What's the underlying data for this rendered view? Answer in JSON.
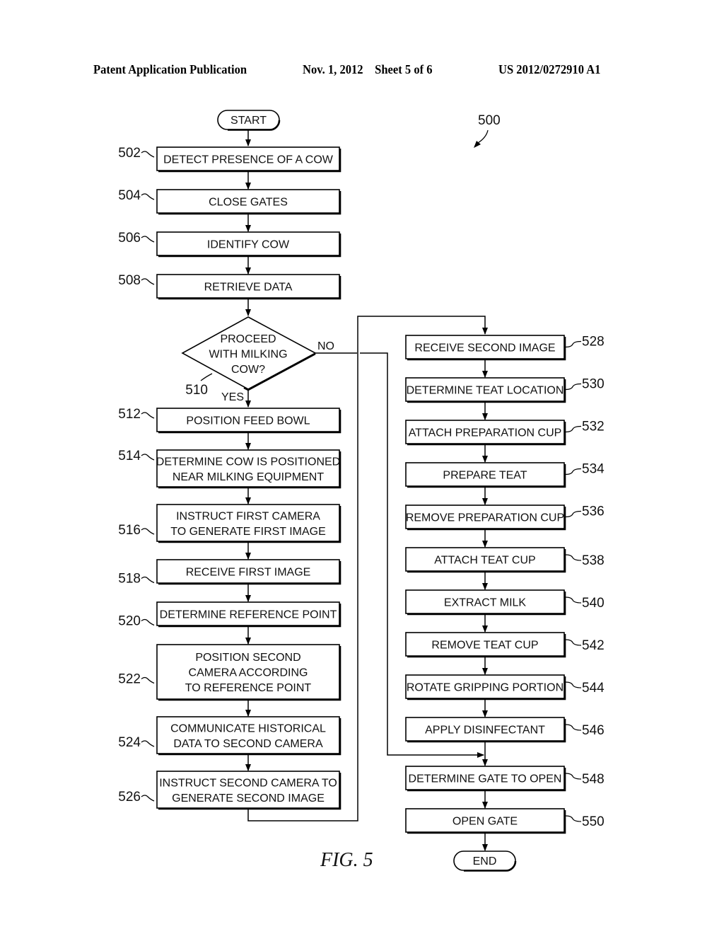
{
  "header": {
    "publication": "Patent Application Publication",
    "date_sheet": "Nov. 1, 2012    Sheet 5 of 6",
    "patent_number": "US 2012/0272910 A1"
  },
  "figure": {
    "label": "FIG. 5",
    "reference": "500"
  },
  "terminals": {
    "start": "START",
    "end": "END"
  },
  "decision": {
    "ref": "510",
    "lines": [
      "PROCEED",
      "WITH MILKING",
      "COW?"
    ],
    "yes_label": "YES",
    "no_label": "NO"
  },
  "left_steps": [
    {
      "ref": "502",
      "lines": [
        "DETECT PRESENCE OF A COW"
      ]
    },
    {
      "ref": "504",
      "lines": [
        "CLOSE GATES"
      ]
    },
    {
      "ref": "506",
      "lines": [
        "IDENTIFY COW"
      ]
    },
    {
      "ref": "508",
      "lines": [
        "RETRIEVE DATA"
      ]
    },
    {
      "ref": "512",
      "lines": [
        "POSITION FEED BOWL"
      ]
    },
    {
      "ref": "514",
      "lines": [
        "DETERMINE COW IS POSITIONED",
        "NEAR MILKING EQUIPMENT"
      ]
    },
    {
      "ref": "516",
      "lines": [
        "INSTRUCT FIRST CAMERA",
        "TO GENERATE FIRST IMAGE"
      ]
    },
    {
      "ref": "518",
      "lines": [
        "RECEIVE FIRST IMAGE"
      ]
    },
    {
      "ref": "520",
      "lines": [
        "DETERMINE REFERENCE POINT"
      ]
    },
    {
      "ref": "522",
      "lines": [
        "POSITION SECOND",
        "CAMERA ACCORDING",
        "TO REFERENCE POINT"
      ]
    },
    {
      "ref": "524",
      "lines": [
        "COMMUNICATE HISTORICAL",
        "DATA TO SECOND CAMERA"
      ]
    },
    {
      "ref": "526",
      "lines": [
        "INSTRUCT SECOND CAMERA TO",
        "GENERATE SECOND IMAGE"
      ]
    }
  ],
  "right_steps": [
    {
      "ref": "528",
      "lines": [
        "RECEIVE SECOND IMAGE"
      ]
    },
    {
      "ref": "530",
      "lines": [
        "DETERMINE TEAT LOCATION"
      ]
    },
    {
      "ref": "532",
      "lines": [
        "ATTACH PREPARATION CUP"
      ]
    },
    {
      "ref": "534",
      "lines": [
        "PREPARE TEAT"
      ]
    },
    {
      "ref": "536",
      "lines": [
        "REMOVE PREPARATION CUP"
      ]
    },
    {
      "ref": "538",
      "lines": [
        "ATTACH TEAT CUP"
      ]
    },
    {
      "ref": "540",
      "lines": [
        "EXTRACT MILK"
      ]
    },
    {
      "ref": "542",
      "lines": [
        "REMOVE TEAT CUP"
      ]
    },
    {
      "ref": "544",
      "lines": [
        "ROTATE GRIPPING PORTION"
      ]
    },
    {
      "ref": "546",
      "lines": [
        "APPLY DISINFECTANT"
      ]
    },
    {
      "ref": "548",
      "lines": [
        "DETERMINE GATE TO OPEN"
      ]
    },
    {
      "ref": "550",
      "lines": [
        "OPEN GATE"
      ]
    }
  ]
}
